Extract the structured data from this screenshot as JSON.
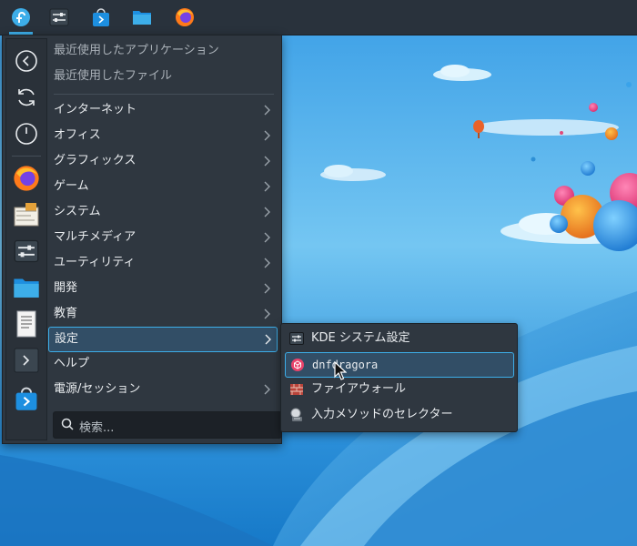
{
  "panel": {
    "launcher": "fedora-launcher-icon",
    "apps": [
      "system-settings-icon",
      "discover-store-icon",
      "dolphin-folder-icon",
      "firefox-icon"
    ]
  },
  "menu": {
    "recent_apps": "最近使用したアプリケーション",
    "recent_files": "最近使用したファイル",
    "categories": [
      "インターネット",
      "オフィス",
      "グラフィックス",
      "ゲーム",
      "システム",
      "マルチメディア",
      "ユーティリティ",
      "開発",
      "教育",
      "設定"
    ],
    "help": "ヘルプ",
    "power": "電源/セッション",
    "search_placeholder": "検索..."
  },
  "submenu": {
    "items": [
      {
        "label": "KDE システム設定",
        "icon": "settings-sliders-icon"
      },
      {
        "label": "dnfdragora",
        "icon": "package-icon"
      },
      {
        "label": "ファイアウォール",
        "icon": "firewall-icon"
      },
      {
        "label": "入力メソッドのセレクター",
        "icon": "input-method-icon"
      }
    ]
  },
  "colors": {
    "accent": "#3daee9",
    "panel": "#29323c",
    "menu_bg": "#2f3740"
  }
}
